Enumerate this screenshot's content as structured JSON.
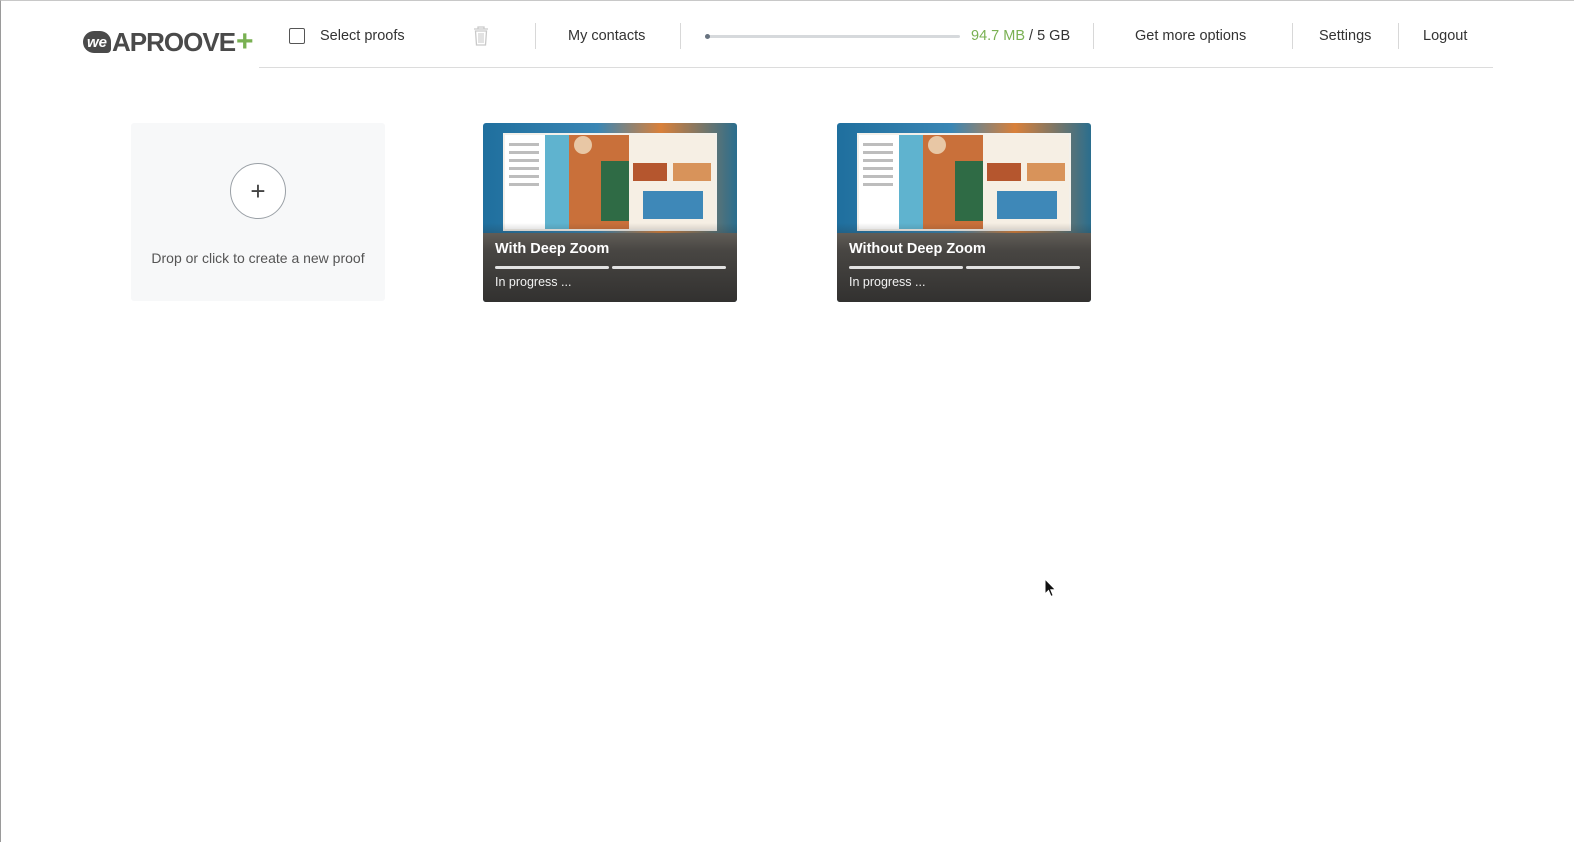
{
  "header": {
    "logo": {
      "we": "we",
      "name": "APROOVE",
      "plus": "+"
    },
    "select_proofs_label": "Select proofs",
    "my_contacts_label": "My contacts",
    "storage": {
      "used": "94.7 MB",
      "separator": " / ",
      "total": "5 GB",
      "used_fraction": 0.02
    },
    "get_more_options_label": "Get more options",
    "settings_label": "Settings",
    "logout_label": "Logout"
  },
  "new_proof": {
    "plus": "+",
    "label": "Drop or click to create a new proof"
  },
  "proofs": [
    {
      "title": "With Deep Zoom",
      "status": "In progress ..."
    },
    {
      "title": "Without Deep Zoom",
      "status": "In progress ..."
    }
  ],
  "colors": {
    "accent_green": "#79b052",
    "text": "#333333",
    "divider": "#dcdcdc"
  },
  "icons": {
    "trash": "trash-icon",
    "checkbox": "checkbox-icon",
    "cursor": "mouse-pointer-icon"
  }
}
